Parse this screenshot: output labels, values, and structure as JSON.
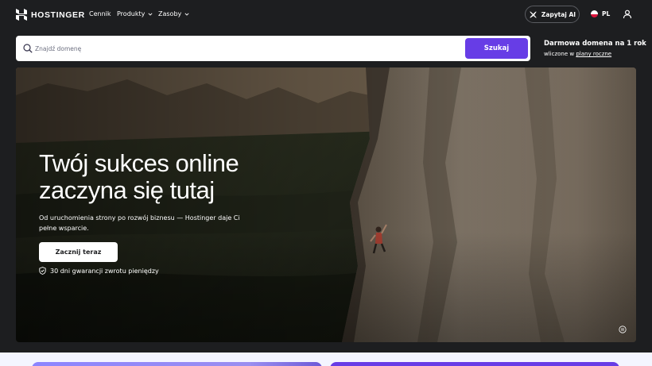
{
  "nav": {
    "logo_text": "HOSTINGER",
    "links": [
      {
        "label": "Cennik"
      },
      {
        "label": "Produkty"
      },
      {
        "label": "Zasoby"
      }
    ],
    "ask_ai_label": "Zapytaj AI",
    "language_label": "PL"
  },
  "search": {
    "placeholder": "Znajdź domenę",
    "button_label": "Szukaj"
  },
  "promo": {
    "title": "Darmowa domena na 1 rok",
    "subtitle_prefix": "wliczone w",
    "link_label": "plany roczne"
  },
  "hero": {
    "title_line1": "Twój sukces online",
    "title_line2": "zaczyna się tutaj",
    "description": "Od uruchomienia strony po rozwój biznesu — Hostinger daje Ci pełne wsparcie.",
    "cta_label": "Zacznij teraz",
    "guarantee": "30 dni gwarancji zwrotu pieniędzy"
  },
  "colors": {
    "brand_purple": "#673de6",
    "page_dark": "#1d1e20",
    "bottom_bg": "#f4f5ff"
  },
  "icons": [
    "hostinger-logo-icon",
    "chevron-down-icon",
    "ai-sparkle-icon",
    "poland-flag-icon",
    "user-icon",
    "search-icon",
    "shield-check-icon",
    "pause-icon"
  ]
}
